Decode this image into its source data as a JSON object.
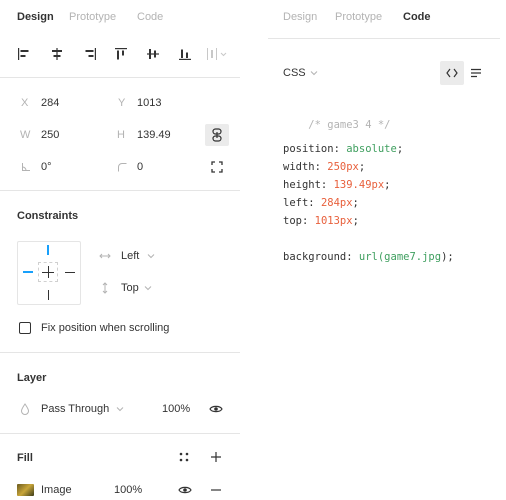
{
  "left_tabs": [
    "Design",
    "Prototype",
    "Code"
  ],
  "right_tabs": [
    "Design",
    "Prototype",
    "Code"
  ],
  "position": {
    "x_label": "X",
    "x_value": "284",
    "y_label": "Y",
    "y_value": "1013",
    "w_label": "W",
    "w_value": "250",
    "h_label": "H",
    "h_value": "139.49",
    "rotation_value": "0°",
    "radius_value": "0"
  },
  "constraints": {
    "title": "Constraints",
    "horizontal": "Left",
    "vertical": "Top",
    "fix_position_label": "Fix position when scrolling"
  },
  "layer": {
    "title": "Layer",
    "blend_mode": "Pass Through",
    "opacity": "100%"
  },
  "fill": {
    "title": "Fill",
    "type": "Image",
    "opacity": "100%"
  },
  "code_panel": {
    "language": "CSS",
    "comment": "/* game3 4 */",
    "lines": [
      {
        "prop": "position:",
        "val": "absolute",
        "kind": "s"
      },
      {
        "prop": "width:",
        "val": "250px",
        "kind": "n"
      },
      {
        "prop": "height:",
        "val": "139.49px",
        "kind": "n"
      },
      {
        "prop": "left:",
        "val": "284px",
        "kind": "n"
      },
      {
        "prop": "top:",
        "val": "1013px",
        "kind": "n"
      }
    ],
    "background_prop": "background:",
    "background_fn": "url(",
    "background_arg": "game7.jpg",
    "background_end": ");"
  },
  "colors": {
    "accent_blue": "#18a0fb",
    "code_number": "#e8603c",
    "code_string": "#3f9f5f"
  }
}
